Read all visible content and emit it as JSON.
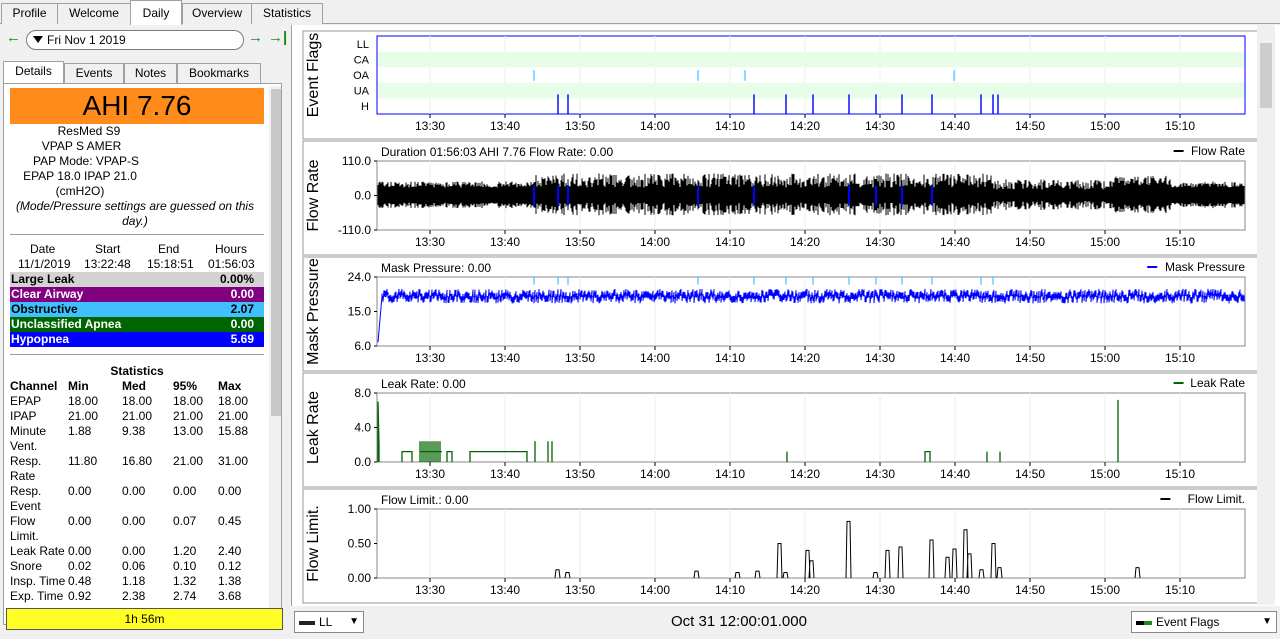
{
  "top_tabs": [
    "Profile",
    "Welcome",
    "Daily",
    "Overview",
    "Statistics"
  ],
  "date": "Fri Nov 1 2019",
  "sub_tabs": [
    "Details",
    "Events",
    "Notes",
    "Bookmarks"
  ],
  "ahi": "AHI 7.76",
  "machine": [
    "ResMed S9",
    "VPAP S AMER",
    "PAP Mode: VPAP-S",
    "EPAP 18.0 IPAP 21.0",
    "(cmH2O)"
  ],
  "guess_note": "(Mode/Pressure settings are guessed on this day.)",
  "session": {
    "headers": [
      "Date",
      "Start",
      "End",
      "Hours"
    ],
    "values": [
      "11/1/2019",
      "13:22:48",
      "15:18:51",
      "01:56:03"
    ]
  },
  "events": [
    {
      "label": "Large Leak",
      "value": "0.00%",
      "color": "#d3d3d3",
      "text": "#000000"
    },
    {
      "label": "Clear Airway",
      "value": "0.00",
      "color": "#800080",
      "text": "#ffffff"
    },
    {
      "label": "Obstructive",
      "value": "2.07",
      "color": "#40c0ff",
      "text": "#000000"
    },
    {
      "label": "Unclassified Apnea",
      "value": "0.00",
      "color": "#006400",
      "text": "#ffffff"
    },
    {
      "label": "Hypopnea",
      "value": "5.69",
      "color": "#0000ff",
      "text": "#ffffff"
    }
  ],
  "stats": {
    "title": "Statistics",
    "headers": [
      "Channel",
      "Min",
      "Med",
      "95%",
      "Max"
    ],
    "rows": [
      [
        "EPAP",
        "18.00",
        "18.00",
        "18.00",
        "18.00"
      ],
      [
        "IPAP",
        "21.00",
        "21.00",
        "21.00",
        "21.00"
      ],
      [
        "Minute\nVent.",
        "1.88",
        "9.38",
        "13.00",
        "15.88"
      ],
      [
        "Resp.\nRate",
        "11.80",
        "16.80",
        "21.00",
        "31.00"
      ],
      [
        "Resp.\nEvent",
        "0.00",
        "0.00",
        "0.00",
        "0.00"
      ],
      [
        "Flow\nLimit.",
        "0.00",
        "0.00",
        "0.07",
        "0.45"
      ],
      [
        "Leak Rate",
        "0.00",
        "0.00",
        "1.20",
        "2.40"
      ],
      [
        "Snore",
        "0.02",
        "0.06",
        "0.10",
        "0.12"
      ],
      [
        "Insp. Time",
        "0.48",
        "1.18",
        "1.32",
        "1.38"
      ],
      [
        "Exp. Time",
        "0.92",
        "2.38",
        "2.74",
        "3.68"
      ]
    ]
  },
  "duration_badge": "1h 56m",
  "time_ticks": [
    "13:30",
    "13:40",
    "13:50",
    "14:00",
    "14:10",
    "14:20",
    "14:30",
    "14:40",
    "14:50",
    "15:00",
    "15:10"
  ],
  "graphs": {
    "flags": {
      "ylabel": "Event Flags",
      "rows": [
        "LL",
        "CA",
        "OA",
        "UA",
        "H"
      ]
    },
    "flow": {
      "ylabel": "Flow Rate",
      "title": "Duration 01:56:03 AHI 7.76 Flow Rate: 0.00",
      "legend": "Flow Rate",
      "ticks": [
        "110.0",
        "0.0",
        "-110.0"
      ]
    },
    "mask": {
      "ylabel": "Mask Pressure",
      "title": "Mask Pressure: 0.00",
      "legend": "Mask Pressure",
      "ticks": [
        "24.0",
        "15.0",
        "6.0"
      ]
    },
    "leak": {
      "ylabel": "Leak Rate",
      "title": "Leak Rate: 0.00",
      "legend": "Leak Rate",
      "ticks": [
        "8.0",
        "4.0",
        "0.0"
      ]
    },
    "flowlim": {
      "ylabel": "Flow Limit.",
      "title": "Flow Limit.: 0.00",
      "legend": "Flow Limit.",
      "ticks": [
        "1.00",
        "0.50",
        "0.00"
      ]
    }
  },
  "bottom": {
    "left_combo": "LL",
    "timestamp": "Oct 31 12:00:01.000",
    "right_combo": "Event Flags"
  },
  "colors": {
    "flow": "#000000",
    "mask": "#0000ff",
    "leak": "#006400",
    "flowlim": "#000000",
    "flag_bg": "#e8fde8",
    "oa": "#40c0ff",
    "h": "#0000ff"
  }
}
